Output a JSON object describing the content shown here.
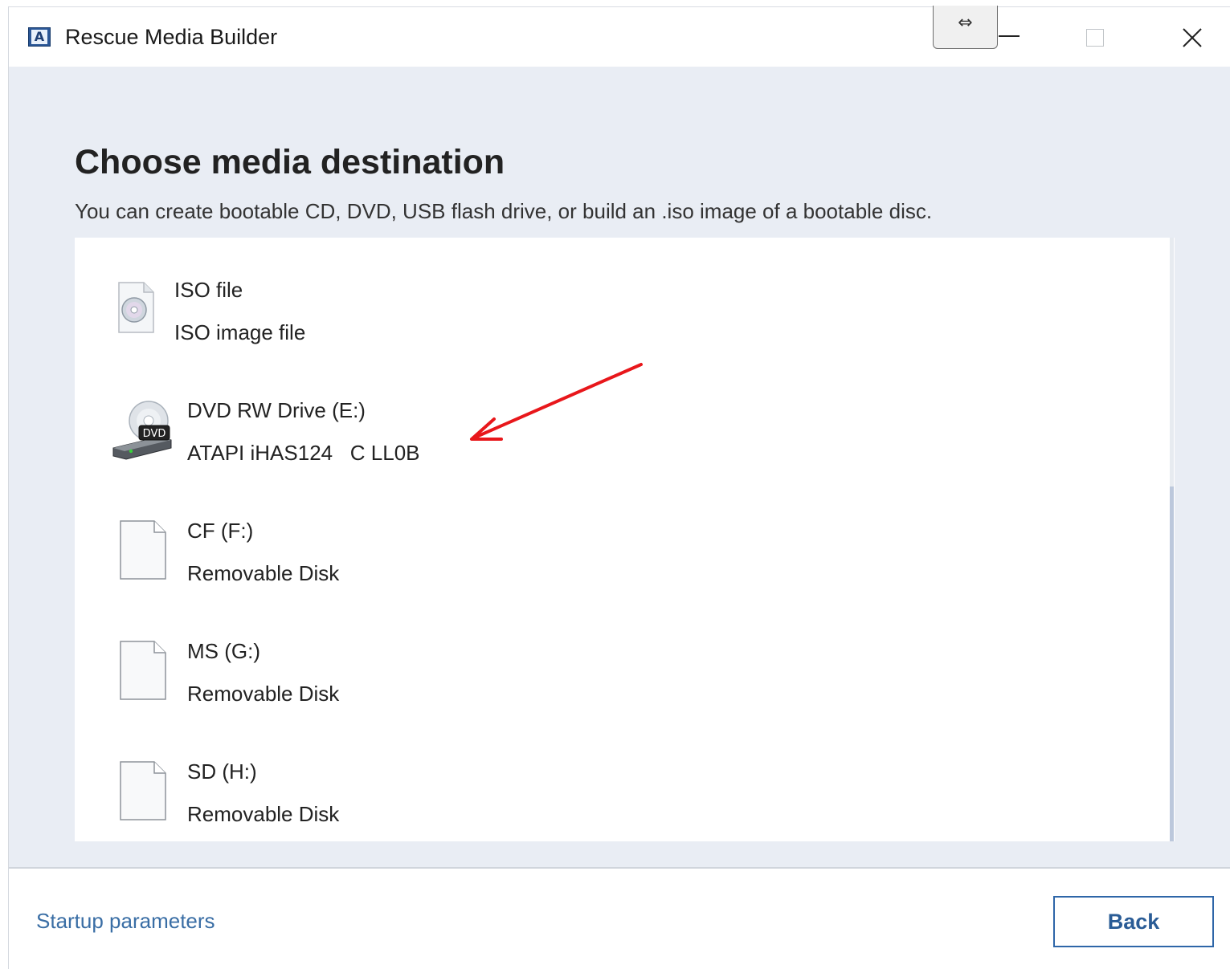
{
  "window": {
    "title": "Rescue Media Builder",
    "app_icon_letter": "A",
    "resize_cursor_glyph": "⇔",
    "controls": [
      "minimize-icon",
      "maximize-icon",
      "close-icon"
    ]
  },
  "page": {
    "heading": "Choose media destination",
    "subheading": "You can create bootable CD, DVD, USB flash drive, or build an .iso image of a bootable disc."
  },
  "media_list": [
    {
      "name": "ISO file",
      "description": "ISO image file",
      "icon": "iso-file-icon"
    },
    {
      "name": "DVD RW Drive (E:)",
      "description": "ATAPI iHAS124   C LL0B",
      "icon": "dvd-drive-icon",
      "icon_label": "DVD"
    },
    {
      "name": "CF (F:)",
      "description": "Removable Disk",
      "icon": "removable-disk-icon"
    },
    {
      "name": "MS (G:)",
      "description": "Removable Disk",
      "icon": "removable-disk-icon"
    },
    {
      "name": "SD (H:)",
      "description": "Removable Disk",
      "icon": "removable-disk-icon"
    }
  ],
  "annotation": {
    "color": "#e8171b",
    "icon": "red-arrow-icon"
  },
  "footer": {
    "startup_link": "Startup parameters",
    "back_label": "Back"
  },
  "colors": {
    "content_bg": "#e9edf4",
    "accent": "#2e66a8",
    "link": "#3a6ea5"
  }
}
